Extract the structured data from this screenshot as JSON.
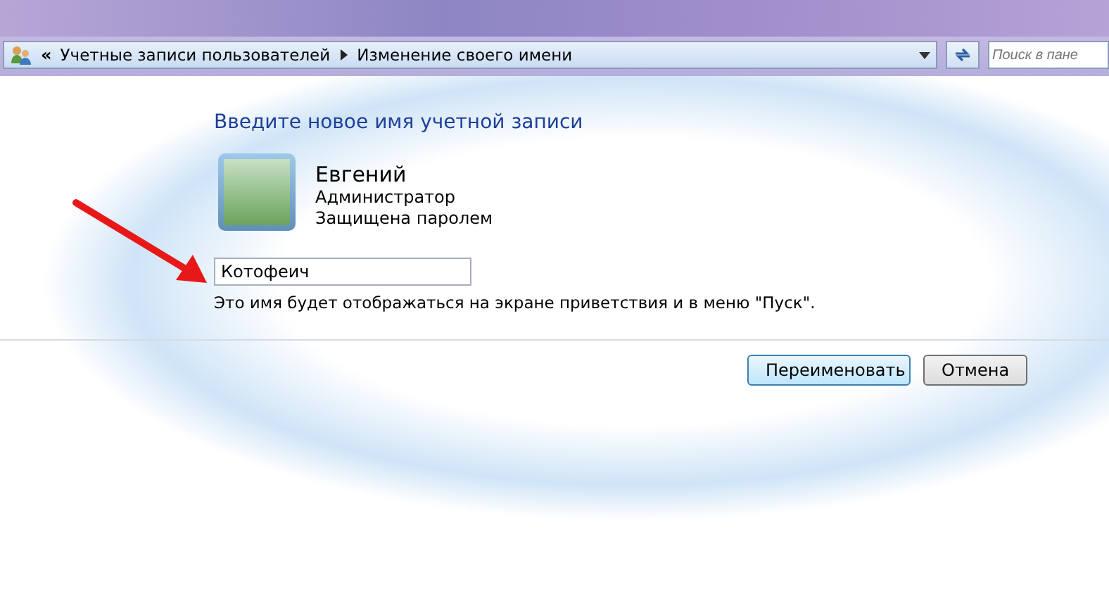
{
  "address_bar": {
    "breadcrumbs": [
      {
        "label": "Учетные записи пользователей"
      },
      {
        "label": "Изменение своего имени"
      }
    ],
    "overflow": "«",
    "search": {
      "placeholder": "Поиск в пане"
    }
  },
  "heading": "Введите новое имя учетной записи",
  "account": {
    "name": "Евгений",
    "role": "Администратор",
    "protection": "Защищена паролем"
  },
  "name_field": {
    "value": "Котофеич"
  },
  "note": "Это имя будет отображаться на экране приветствия и в меню \"Пуск\".",
  "buttons": [
    {
      "label": "Переименовать",
      "kind": "default"
    },
    {
      "label": "Отмена",
      "kind": "normal"
    }
  ]
}
